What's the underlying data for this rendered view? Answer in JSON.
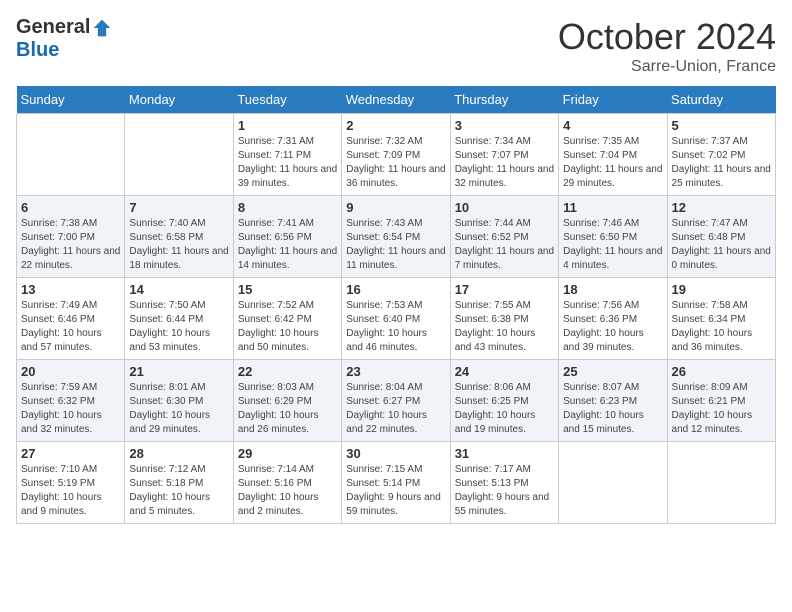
{
  "logo": {
    "general": "General",
    "blue": "Blue"
  },
  "title": "October 2024",
  "subtitle": "Sarre-Union, France",
  "days_of_week": [
    "Sunday",
    "Monday",
    "Tuesday",
    "Wednesday",
    "Thursday",
    "Friday",
    "Saturday"
  ],
  "weeks": [
    [
      {
        "day": "",
        "info": ""
      },
      {
        "day": "",
        "info": ""
      },
      {
        "day": "1",
        "info": "Sunrise: 7:31 AM\nSunset: 7:11 PM\nDaylight: 11 hours and 39 minutes."
      },
      {
        "day": "2",
        "info": "Sunrise: 7:32 AM\nSunset: 7:09 PM\nDaylight: 11 hours and 36 minutes."
      },
      {
        "day": "3",
        "info": "Sunrise: 7:34 AM\nSunset: 7:07 PM\nDaylight: 11 hours and 32 minutes."
      },
      {
        "day": "4",
        "info": "Sunrise: 7:35 AM\nSunset: 7:04 PM\nDaylight: 11 hours and 29 minutes."
      },
      {
        "day": "5",
        "info": "Sunrise: 7:37 AM\nSunset: 7:02 PM\nDaylight: 11 hours and 25 minutes."
      }
    ],
    [
      {
        "day": "6",
        "info": "Sunrise: 7:38 AM\nSunset: 7:00 PM\nDaylight: 11 hours and 22 minutes."
      },
      {
        "day": "7",
        "info": "Sunrise: 7:40 AM\nSunset: 6:58 PM\nDaylight: 11 hours and 18 minutes."
      },
      {
        "day": "8",
        "info": "Sunrise: 7:41 AM\nSunset: 6:56 PM\nDaylight: 11 hours and 14 minutes."
      },
      {
        "day": "9",
        "info": "Sunrise: 7:43 AM\nSunset: 6:54 PM\nDaylight: 11 hours and 11 minutes."
      },
      {
        "day": "10",
        "info": "Sunrise: 7:44 AM\nSunset: 6:52 PM\nDaylight: 11 hours and 7 minutes."
      },
      {
        "day": "11",
        "info": "Sunrise: 7:46 AM\nSunset: 6:50 PM\nDaylight: 11 hours and 4 minutes."
      },
      {
        "day": "12",
        "info": "Sunrise: 7:47 AM\nSunset: 6:48 PM\nDaylight: 11 hours and 0 minutes."
      }
    ],
    [
      {
        "day": "13",
        "info": "Sunrise: 7:49 AM\nSunset: 6:46 PM\nDaylight: 10 hours and 57 minutes."
      },
      {
        "day": "14",
        "info": "Sunrise: 7:50 AM\nSunset: 6:44 PM\nDaylight: 10 hours and 53 minutes."
      },
      {
        "day": "15",
        "info": "Sunrise: 7:52 AM\nSunset: 6:42 PM\nDaylight: 10 hours and 50 minutes."
      },
      {
        "day": "16",
        "info": "Sunrise: 7:53 AM\nSunset: 6:40 PM\nDaylight: 10 hours and 46 minutes."
      },
      {
        "day": "17",
        "info": "Sunrise: 7:55 AM\nSunset: 6:38 PM\nDaylight: 10 hours and 43 minutes."
      },
      {
        "day": "18",
        "info": "Sunrise: 7:56 AM\nSunset: 6:36 PM\nDaylight: 10 hours and 39 minutes."
      },
      {
        "day": "19",
        "info": "Sunrise: 7:58 AM\nSunset: 6:34 PM\nDaylight: 10 hours and 36 minutes."
      }
    ],
    [
      {
        "day": "20",
        "info": "Sunrise: 7:59 AM\nSunset: 6:32 PM\nDaylight: 10 hours and 32 minutes."
      },
      {
        "day": "21",
        "info": "Sunrise: 8:01 AM\nSunset: 6:30 PM\nDaylight: 10 hours and 29 minutes."
      },
      {
        "day": "22",
        "info": "Sunrise: 8:03 AM\nSunset: 6:29 PM\nDaylight: 10 hours and 26 minutes."
      },
      {
        "day": "23",
        "info": "Sunrise: 8:04 AM\nSunset: 6:27 PM\nDaylight: 10 hours and 22 minutes."
      },
      {
        "day": "24",
        "info": "Sunrise: 8:06 AM\nSunset: 6:25 PM\nDaylight: 10 hours and 19 minutes."
      },
      {
        "day": "25",
        "info": "Sunrise: 8:07 AM\nSunset: 6:23 PM\nDaylight: 10 hours and 15 minutes."
      },
      {
        "day": "26",
        "info": "Sunrise: 8:09 AM\nSunset: 6:21 PM\nDaylight: 10 hours and 12 minutes."
      }
    ],
    [
      {
        "day": "27",
        "info": "Sunrise: 7:10 AM\nSunset: 5:19 PM\nDaylight: 10 hours and 9 minutes."
      },
      {
        "day": "28",
        "info": "Sunrise: 7:12 AM\nSunset: 5:18 PM\nDaylight: 10 hours and 5 minutes."
      },
      {
        "day": "29",
        "info": "Sunrise: 7:14 AM\nSunset: 5:16 PM\nDaylight: 10 hours and 2 minutes."
      },
      {
        "day": "30",
        "info": "Sunrise: 7:15 AM\nSunset: 5:14 PM\nDaylight: 9 hours and 59 minutes."
      },
      {
        "day": "31",
        "info": "Sunrise: 7:17 AM\nSunset: 5:13 PM\nDaylight: 9 hours and 55 minutes."
      },
      {
        "day": "",
        "info": ""
      },
      {
        "day": "",
        "info": ""
      }
    ]
  ]
}
